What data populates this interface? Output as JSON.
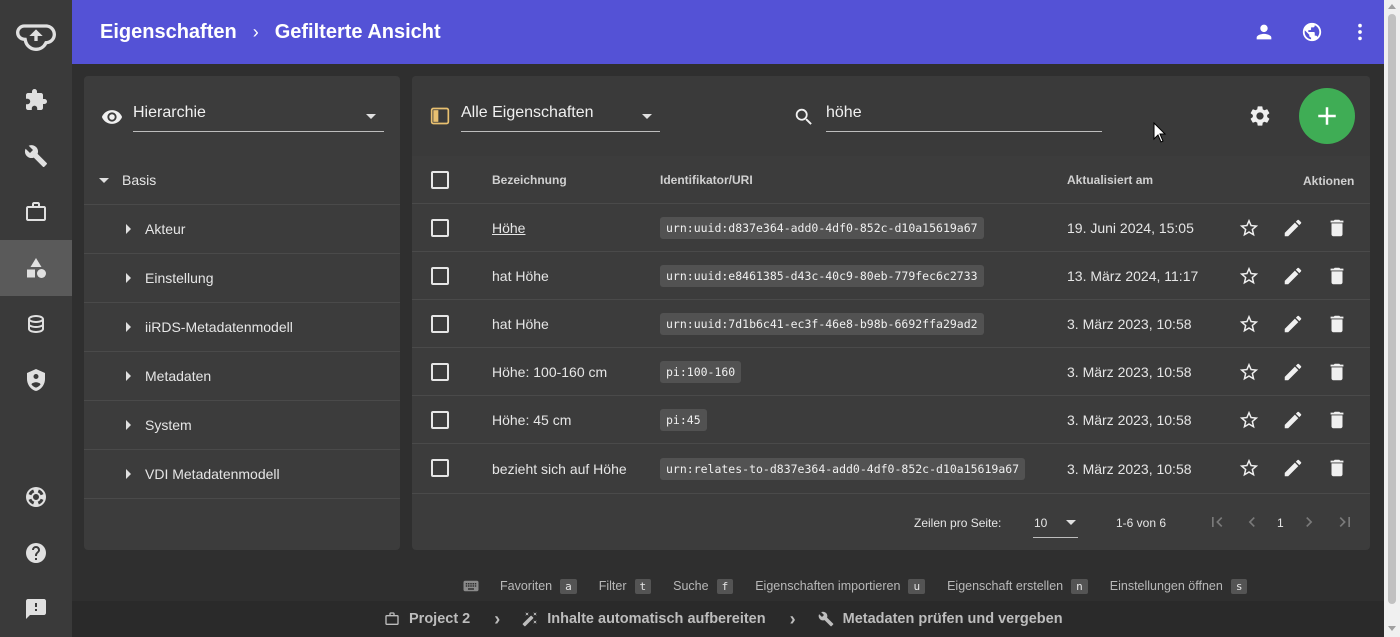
{
  "header": {
    "crumb1": "Eigenschaften",
    "crumb_sep": "›",
    "crumb2": "Gefilterte Ansicht"
  },
  "left_panel": {
    "view_select": "Hierarchie",
    "tree": {
      "root": "Basis",
      "children": [
        "Akteur",
        "Einstellung",
        "iiRDS-Metadatenmodell",
        "Metadaten",
        "System",
        "VDI Metadatenmodell"
      ]
    }
  },
  "toolbar": {
    "filter_select": "Alle Eigenschaften",
    "search_value": "höhe"
  },
  "table": {
    "headers": {
      "name": "Bezeichnung",
      "uri": "Identifikator/URI",
      "updated": "Aktualisiert am",
      "actions": "Aktionen"
    },
    "rows": [
      {
        "name": "Höhe",
        "uri": "urn:uuid:d837e364-add0-4df0-852c-d10a15619a67",
        "updated": "19. Juni 2024, 15:05"
      },
      {
        "name": "hat Höhe",
        "uri": "urn:uuid:e8461385-d43c-40c9-80eb-779fec6c2733",
        "updated": "13. März 2024, 11:17"
      },
      {
        "name": "hat Höhe",
        "uri": "urn:uuid:7d1b6c41-ec3f-46e8-b98b-6692ffa29ad2",
        "updated": "3. März 2023, 10:58"
      },
      {
        "name": "Höhe: 100-160 cm",
        "uri": "pi:100-160",
        "updated": "3. März 2023, 10:58"
      },
      {
        "name": "Höhe: 45 cm",
        "uri": "pi:45",
        "updated": "3. März 2023, 10:58"
      },
      {
        "name": "bezieht sich auf Höhe",
        "uri": "urn:relates-to-d837e364-add0-4df0-852c-d10a15619a67",
        "updated": "3. März 2023, 10:58"
      }
    ]
  },
  "pagination": {
    "rows_label": "Zeilen pro Seite:",
    "rows_value": "10",
    "range": "1-6 von 6",
    "page": "1"
  },
  "shortcuts": [
    {
      "label": "Favoriten",
      "key": "a"
    },
    {
      "label": "Filter",
      "key": "t"
    },
    {
      "label": "Suche",
      "key": "f"
    },
    {
      "label": "Eigenschaften importieren",
      "key": "u"
    },
    {
      "label": "Eigenschaft erstellen",
      "key": "n"
    },
    {
      "label": "Einstellungen öffnen",
      "key": "s"
    }
  ],
  "bottom_breadcrumb": {
    "project": "Project 2",
    "step1": "Inhalte automatisch aufbereiten",
    "step2": "Metadaten prüfen und vergeben",
    "sep": "›"
  },
  "colors": {
    "accent": "#5452d6",
    "fab": "#3fad55",
    "rail": "#3a3a3a",
    "background": "#2f2f2f",
    "panel": "#3c3c3c"
  }
}
